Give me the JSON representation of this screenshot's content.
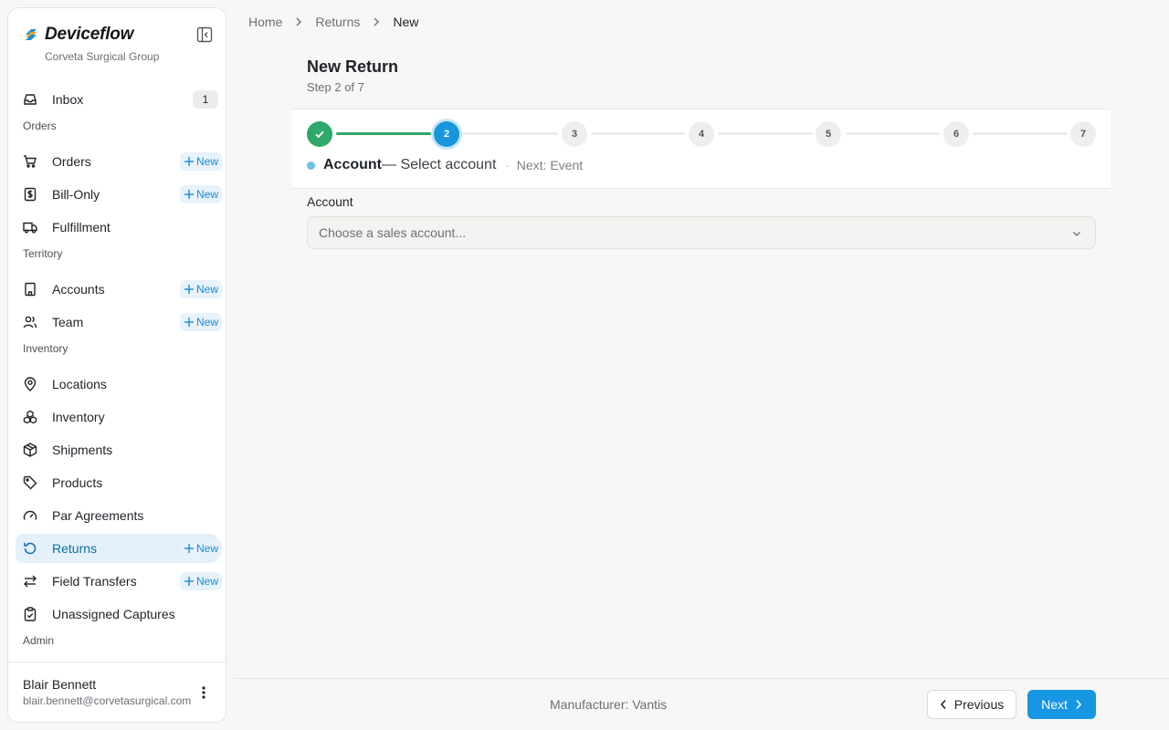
{
  "brand": {
    "name": "Deviceflow",
    "org": "Corveta Surgical Group"
  },
  "sidebar": {
    "inbox": {
      "label": "Inbox",
      "count": "1"
    },
    "sections": {
      "orders": "Orders",
      "territory": "Territory",
      "inventory": "Inventory",
      "admin": "Admin"
    },
    "new_label": "New",
    "items": {
      "orders": "Orders",
      "bill_only": "Bill-Only",
      "fulfillment": "Fulfillment",
      "accounts": "Accounts",
      "team": "Team",
      "locations": "Locations",
      "inventory": "Inventory",
      "shipments": "Shipments",
      "products": "Products",
      "par_agreements": "Par Agreements",
      "returns": "Returns",
      "field_transfers": "Field Transfers",
      "unassigned_captures": "Unassigned Captures"
    },
    "active_item": "Returns",
    "user": {
      "name": "Blair Bennett",
      "email": "blair.bennett@corvetasurgical.com"
    }
  },
  "breadcrumb": [
    "Home",
    "Returns",
    "New"
  ],
  "page": {
    "title": "New Return",
    "subtitle": "Step 2 of 7"
  },
  "stepper": {
    "steps": [
      "1",
      "2",
      "3",
      "4",
      "5",
      "6",
      "7"
    ],
    "current_step": 2,
    "current_name": "Account",
    "current_desc": "— Select account",
    "separator": "·",
    "next_label": "Next: Event"
  },
  "form": {
    "account_label": "Account",
    "account_placeholder": "Choose a sales account..."
  },
  "footer": {
    "manufacturer": "Manufacturer: Vantis",
    "previous_label": "Previous",
    "next_label": "Next"
  },
  "colors": {
    "accent": "#1796e4",
    "success": "#2ea96a",
    "active_bg": "#e4f1fa"
  }
}
